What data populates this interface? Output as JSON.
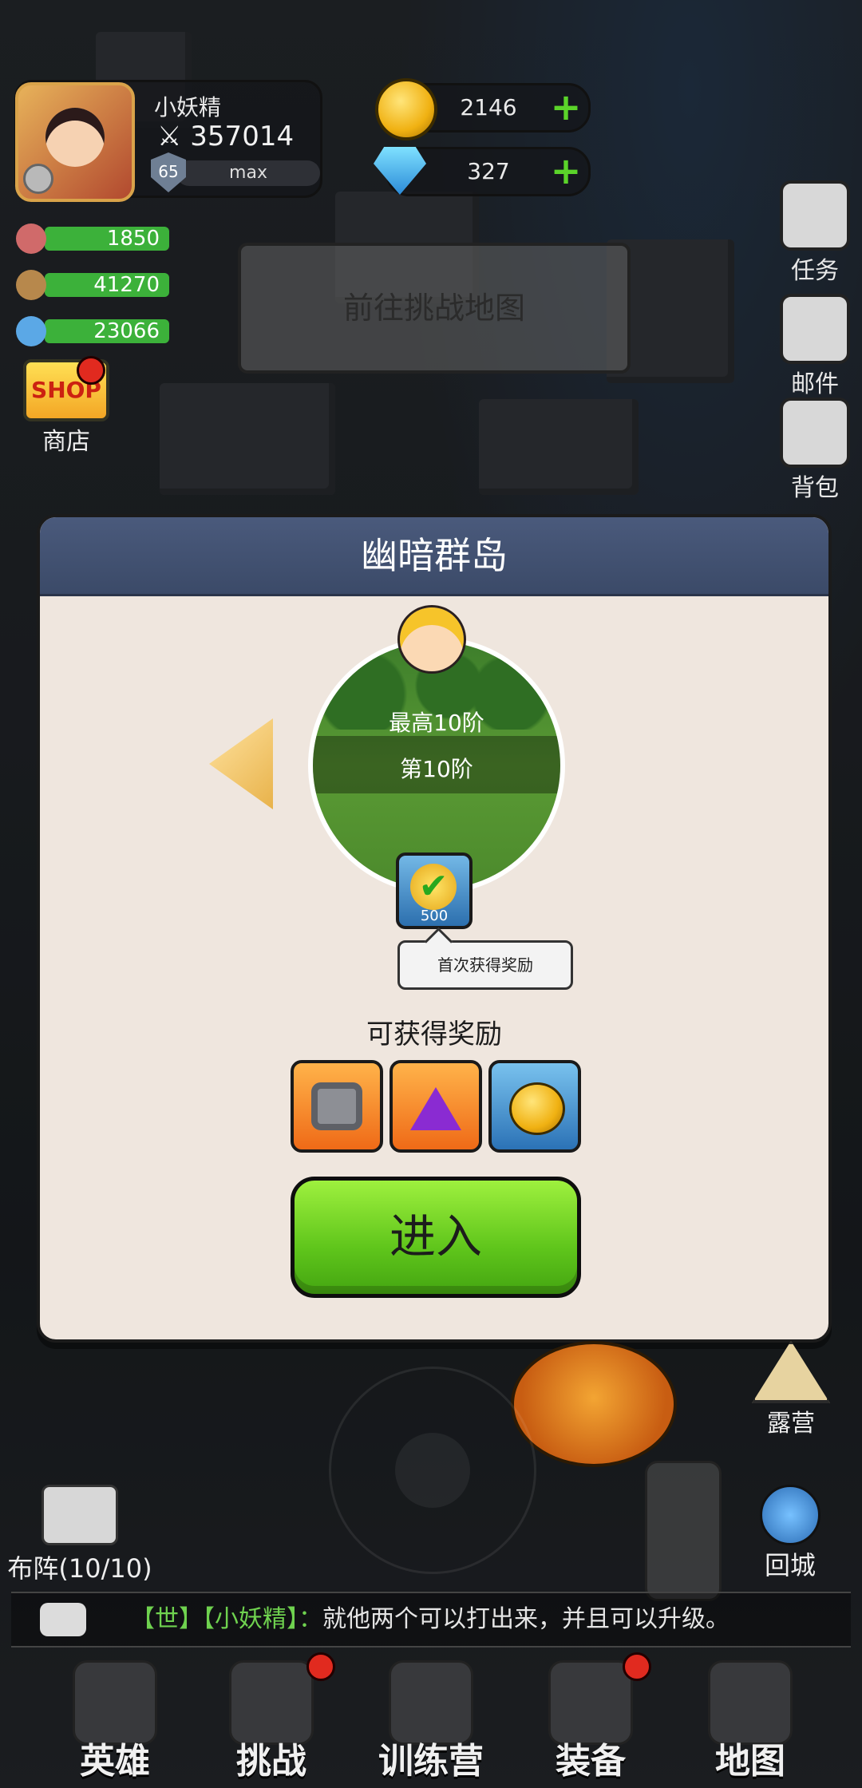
{
  "player": {
    "name": "小妖精",
    "power": "357014",
    "level": "65",
    "level_status": "max"
  },
  "currency": {
    "gold": "2146",
    "gems": "327"
  },
  "resources": [
    {
      "icon": "meat-icon",
      "value": "1850"
    },
    {
      "icon": "wood-icon",
      "value": "41270"
    },
    {
      "icon": "crystal-icon",
      "value": "23066"
    }
  ],
  "side_right": [
    "任务",
    "邮件",
    "背包"
  ],
  "shop": {
    "logo": "SHOP",
    "label": "商店"
  },
  "goto_challenge": "前往挑战地图",
  "modal": {
    "title": "幽暗群岛",
    "highest_stage": "最高10阶",
    "current_stage": "第10阶",
    "first_reward_qty": "500",
    "first_reward_tip": "首次获得奖励",
    "rewards_title": "可获得奖励",
    "reward_icons": [
      "rune-stone-icon",
      "purple-dust-icon",
      "gold-coin-icon"
    ],
    "enter_label": "进入"
  },
  "world": {
    "camp_label": "露营",
    "formation_label": "布阵(10/10)",
    "return_label": "回城"
  },
  "chat": {
    "channel": "【世】",
    "speaker": "【小妖精】：",
    "message": "就他两个可以打出来，并且可以升级。"
  },
  "nav": [
    "英雄",
    "挑战",
    "训练营",
    "装备",
    "地图"
  ],
  "colors": {
    "enter_green": "#5fc51b",
    "modal_header": "#3b4a68",
    "modal_bg": "#efe6de",
    "resource_green": "#3cb13a"
  }
}
